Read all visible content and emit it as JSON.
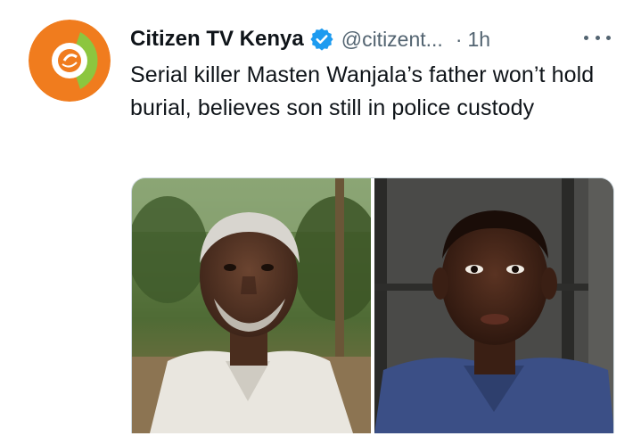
{
  "tweet": {
    "display_name": "Citizen TV Kenya",
    "handle": "@citizent...",
    "separator": "·",
    "time": "1h",
    "text": "Serial killer Masten Wanjala’s father won’t hold burial, believes son still in police custody",
    "verified_icon": "verified-badge-icon",
    "more_icon": "more-options-icon",
    "avatar_icon": "citizen-tv-logo"
  },
  "colors": {
    "text_primary": "#0f1419",
    "text_secondary": "#536471",
    "verified_blue": "#1d9bf0",
    "logo_orange": "#f07c1e",
    "logo_green": "#8cc63f"
  },
  "media": {
    "photos": [
      {
        "name": "father-photo"
      },
      {
        "name": "son-photo"
      }
    ]
  }
}
